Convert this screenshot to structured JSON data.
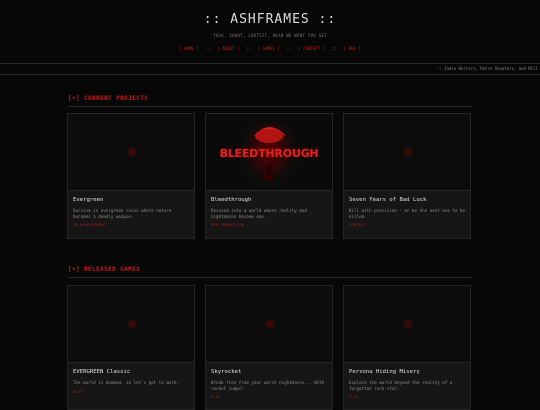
{
  "header": {
    "title": ":: ASHFRAMES ::",
    "tagline": "TALK, SHOOT, LOOTSIT, HEAR WE WANT YOU SET"
  },
  "nav": {
    "items": [
      "[ HOME ]",
      "[ ABOUT ]",
      "[ GAMES ]",
      "[ CONTACT ]",
      "[ DEV ]"
    ],
    "separator": "::"
  },
  "ticker": {
    "text": ":: Indie Horrors, Retro Shooters, and Mill"
  },
  "sections": {
    "current": {
      "title": "[+] CURRENT PROJECTS",
      "cards": [
        {
          "title": "Evergreen",
          "desc": "Survive in evergreen ruins where nature becomes a deadly weapon.",
          "status": "IN DEVELOPMENT",
          "thumb_icon": "red-dot-icon"
        },
        {
          "title": "Bleedthrough",
          "desc": "Descend into a world where reality and nightmares become one.",
          "status": "PRE-PRODUCTION",
          "thumb_text": "BLEEDTHROUGH"
        },
        {
          "title": "Seven Years of Bad Luck",
          "desc": "Kill with precision - or be the next one to be killed.",
          "status": "CONCEPT",
          "thumb_icon": "red-dot-icon"
        }
      ]
    },
    "released": {
      "title": "[+] RELEASED GAMES",
      "cards": [
        {
          "title": "EVERGREEN Classic",
          "desc": "The world is doomed, so let's get to work.",
          "status": "PLAY",
          "thumb_icon": "red-dot-icon"
        },
        {
          "title": "Skyrocket",
          "desc": "Break free from your worst nightmares... With rocket jumps!",
          "status": "PLAY",
          "thumb_icon": "red-dot-icon"
        },
        {
          "title": "Persona Hiding Misery",
          "desc": "Explore the world beyond the reality of a forgotten rock star.",
          "status": "PLAY",
          "thumb_icon": "red-dot-icon"
        }
      ]
    }
  },
  "colors": {
    "accent": "#c81e1e",
    "background": "#070707",
    "card": "#161616"
  }
}
